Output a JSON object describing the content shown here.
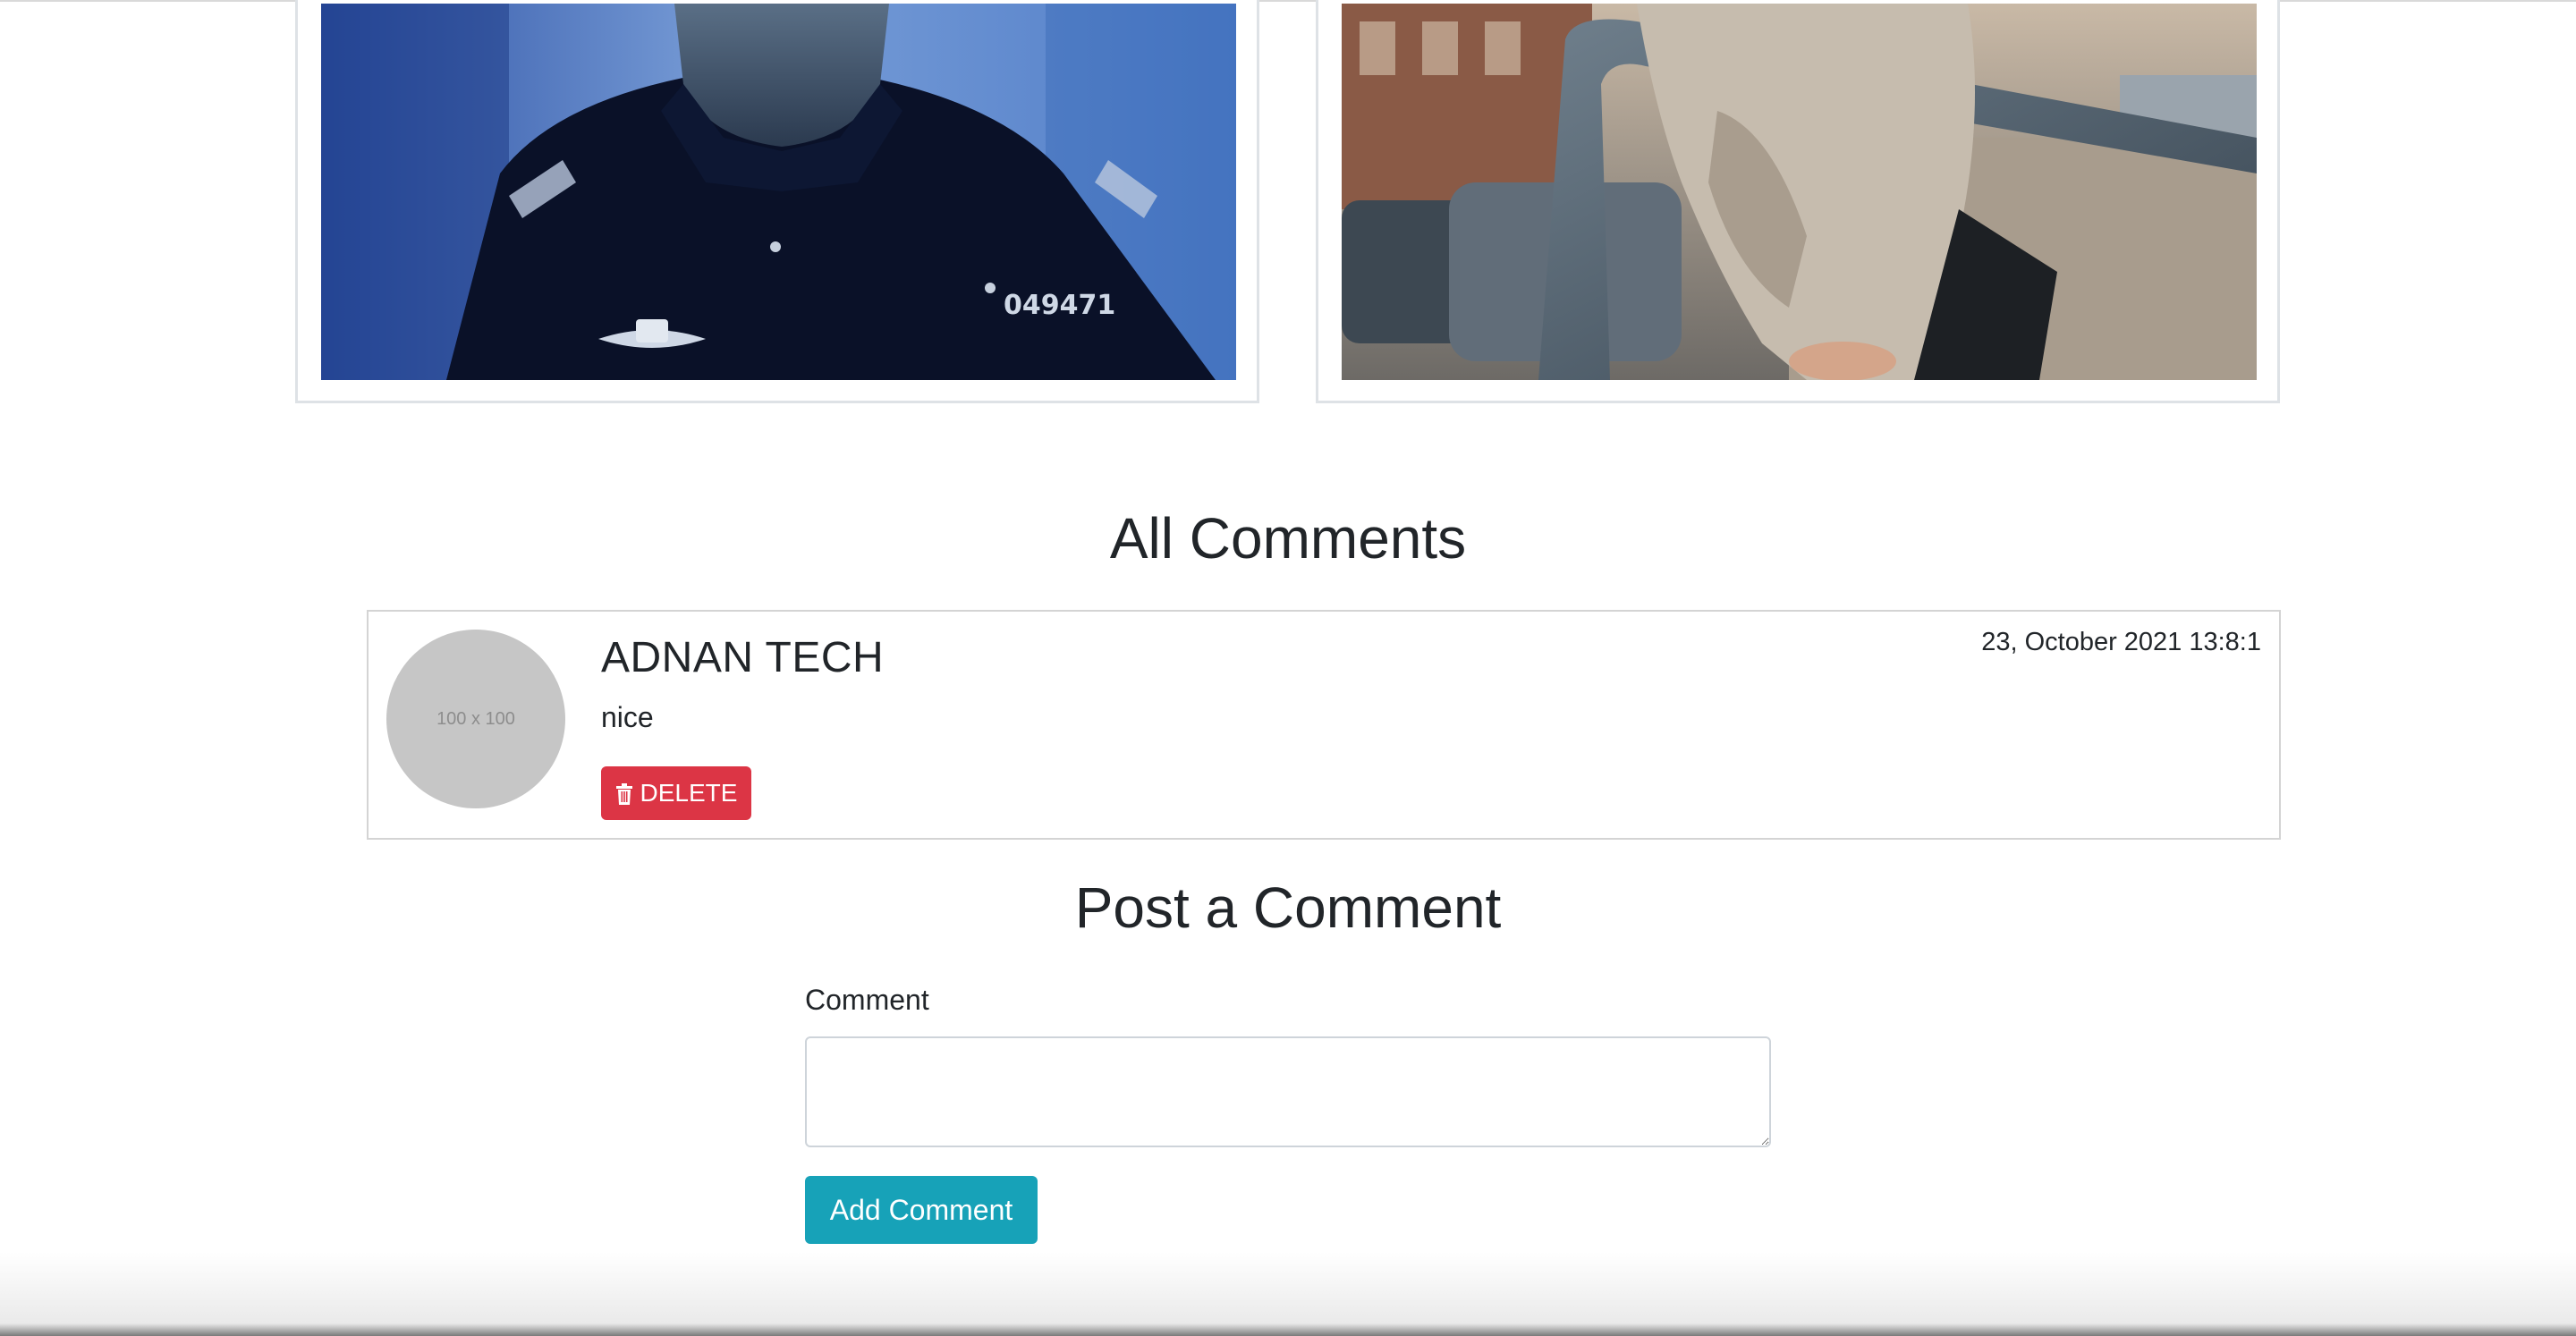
{
  "gallery": {
    "images": [
      {
        "name": "officer-photo",
        "plate_text": "049471"
      },
      {
        "name": "car-door-photo"
      }
    ]
  },
  "comments_section": {
    "title": "All Comments",
    "comments": [
      {
        "avatar_placeholder": "100 x 100",
        "author": "ADNAN TECH",
        "text": "nice",
        "date": "23, October 2021 13:8:1",
        "delete_label": "DELETE"
      }
    ]
  },
  "post_comment": {
    "title": "Post a Comment",
    "field_label": "Comment",
    "field_value": "",
    "submit_label": "Add Comment"
  },
  "colors": {
    "danger": "#dc3545",
    "info": "#17a2b8",
    "avatar": "#c6c6c6"
  }
}
